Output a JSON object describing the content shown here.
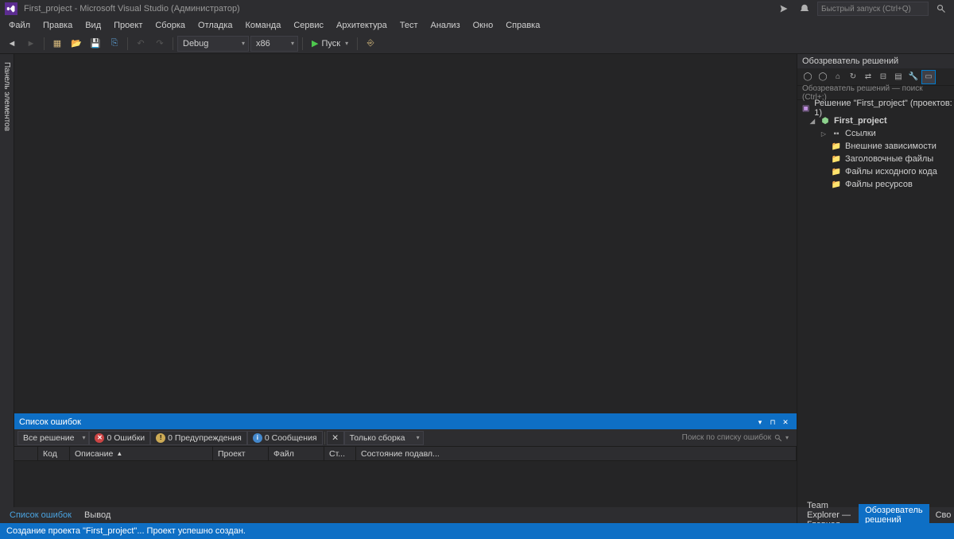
{
  "titlebar": {
    "title": "First_project - Microsoft Visual Studio (Администратор)",
    "quick_launch_placeholder": "Быстрый запуск (Ctrl+Q)"
  },
  "menu": [
    "Файл",
    "Правка",
    "Вид",
    "Проект",
    "Сборка",
    "Отладка",
    "Команда",
    "Сервис",
    "Архитектура",
    "Тест",
    "Анализ",
    "Окно",
    "Справка"
  ],
  "toolbar": {
    "config": "Debug",
    "platform": "x86",
    "run_label": "Пуск"
  },
  "left_dock": {
    "toolbox": "Панель элементов"
  },
  "solution_explorer": {
    "title": "Обозреватель решений",
    "search_placeholder": "Обозреватель решений — поиск (Ctrl+;)",
    "solution_label": "Решение \"First_project\" (проектов: 1)",
    "project": "First_project",
    "nodes": {
      "refs": "Ссылки",
      "ext_deps": "Внешние зависимости",
      "headers": "Заголовочные файлы",
      "sources": "Файлы исходного кода",
      "resources": "Файлы ресурсов"
    }
  },
  "error_list": {
    "title": "Список ошибок",
    "scope": "Все решение",
    "errors": "0 Ошибки",
    "warnings": "0 Предупреждения",
    "messages": "0 Сообщения",
    "build_filter": "Только сборка",
    "search_placeholder": "Поиск по списку ошибок",
    "cols": {
      "code": "Код",
      "desc": "Описание",
      "project": "Проект",
      "file": "Файл",
      "line": "Ст...",
      "suppress": "Состояние подавл..."
    },
    "tabs": {
      "error_list": "Список ошибок",
      "output": "Вывод"
    }
  },
  "right_tabs": {
    "team_explorer": "Team Explorer — Главная",
    "solution_explorer": "Обозреватель решений",
    "properties": "Свой"
  },
  "status": "Создание проекта \"First_project\"... Проект успешно создан."
}
